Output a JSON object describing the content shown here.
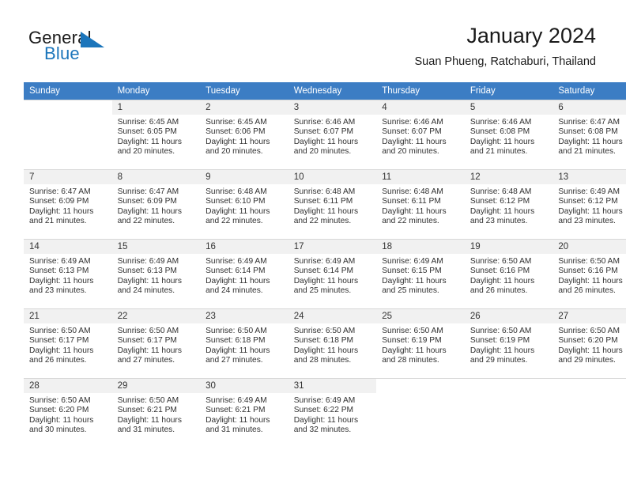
{
  "branding": {
    "name_part1": "General",
    "name_part2": "Blue",
    "accent_color": "#1b75bb"
  },
  "header": {
    "title": "January 2024",
    "subtitle": "Suan Phueng, Ratchaburi, Thailand"
  },
  "calendar": {
    "header_bg": "#3c7dc4",
    "daynum_bg": "#f1f1f1",
    "weekday_headers": [
      "Sunday",
      "Monday",
      "Tuesday",
      "Wednesday",
      "Thursday",
      "Friday",
      "Saturday"
    ],
    "weeks": [
      [
        {
          "day": "",
          "sunrise": "",
          "sunset": "",
          "daylight": "",
          "daylight2": ""
        },
        {
          "day": "1",
          "sunrise": "Sunrise: 6:45 AM",
          "sunset": "Sunset: 6:05 PM",
          "daylight": "Daylight: 11 hours",
          "daylight2": "and 20 minutes."
        },
        {
          "day": "2",
          "sunrise": "Sunrise: 6:45 AM",
          "sunset": "Sunset: 6:06 PM",
          "daylight": "Daylight: 11 hours",
          "daylight2": "and 20 minutes."
        },
        {
          "day": "3",
          "sunrise": "Sunrise: 6:46 AM",
          "sunset": "Sunset: 6:07 PM",
          "daylight": "Daylight: 11 hours",
          "daylight2": "and 20 minutes."
        },
        {
          "day": "4",
          "sunrise": "Sunrise: 6:46 AM",
          "sunset": "Sunset: 6:07 PM",
          "daylight": "Daylight: 11 hours",
          "daylight2": "and 20 minutes."
        },
        {
          "day": "5",
          "sunrise": "Sunrise: 6:46 AM",
          "sunset": "Sunset: 6:08 PM",
          "daylight": "Daylight: 11 hours",
          "daylight2": "and 21 minutes."
        },
        {
          "day": "6",
          "sunrise": "Sunrise: 6:47 AM",
          "sunset": "Sunset: 6:08 PM",
          "daylight": "Daylight: 11 hours",
          "daylight2": "and 21 minutes."
        }
      ],
      [
        {
          "day": "7",
          "sunrise": "Sunrise: 6:47 AM",
          "sunset": "Sunset: 6:09 PM",
          "daylight": "Daylight: 11 hours",
          "daylight2": "and 21 minutes."
        },
        {
          "day": "8",
          "sunrise": "Sunrise: 6:47 AM",
          "sunset": "Sunset: 6:09 PM",
          "daylight": "Daylight: 11 hours",
          "daylight2": "and 22 minutes."
        },
        {
          "day": "9",
          "sunrise": "Sunrise: 6:48 AM",
          "sunset": "Sunset: 6:10 PM",
          "daylight": "Daylight: 11 hours",
          "daylight2": "and 22 minutes."
        },
        {
          "day": "10",
          "sunrise": "Sunrise: 6:48 AM",
          "sunset": "Sunset: 6:11 PM",
          "daylight": "Daylight: 11 hours",
          "daylight2": "and 22 minutes."
        },
        {
          "day": "11",
          "sunrise": "Sunrise: 6:48 AM",
          "sunset": "Sunset: 6:11 PM",
          "daylight": "Daylight: 11 hours",
          "daylight2": "and 22 minutes."
        },
        {
          "day": "12",
          "sunrise": "Sunrise: 6:48 AM",
          "sunset": "Sunset: 6:12 PM",
          "daylight": "Daylight: 11 hours",
          "daylight2": "and 23 minutes."
        },
        {
          "day": "13",
          "sunrise": "Sunrise: 6:49 AM",
          "sunset": "Sunset: 6:12 PM",
          "daylight": "Daylight: 11 hours",
          "daylight2": "and 23 minutes."
        }
      ],
      [
        {
          "day": "14",
          "sunrise": "Sunrise: 6:49 AM",
          "sunset": "Sunset: 6:13 PM",
          "daylight": "Daylight: 11 hours",
          "daylight2": "and 23 minutes."
        },
        {
          "day": "15",
          "sunrise": "Sunrise: 6:49 AM",
          "sunset": "Sunset: 6:13 PM",
          "daylight": "Daylight: 11 hours",
          "daylight2": "and 24 minutes."
        },
        {
          "day": "16",
          "sunrise": "Sunrise: 6:49 AM",
          "sunset": "Sunset: 6:14 PM",
          "daylight": "Daylight: 11 hours",
          "daylight2": "and 24 minutes."
        },
        {
          "day": "17",
          "sunrise": "Sunrise: 6:49 AM",
          "sunset": "Sunset: 6:14 PM",
          "daylight": "Daylight: 11 hours",
          "daylight2": "and 25 minutes."
        },
        {
          "day": "18",
          "sunrise": "Sunrise: 6:49 AM",
          "sunset": "Sunset: 6:15 PM",
          "daylight": "Daylight: 11 hours",
          "daylight2": "and 25 minutes."
        },
        {
          "day": "19",
          "sunrise": "Sunrise: 6:50 AM",
          "sunset": "Sunset: 6:16 PM",
          "daylight": "Daylight: 11 hours",
          "daylight2": "and 26 minutes."
        },
        {
          "day": "20",
          "sunrise": "Sunrise: 6:50 AM",
          "sunset": "Sunset: 6:16 PM",
          "daylight": "Daylight: 11 hours",
          "daylight2": "and 26 minutes."
        }
      ],
      [
        {
          "day": "21",
          "sunrise": "Sunrise: 6:50 AM",
          "sunset": "Sunset: 6:17 PM",
          "daylight": "Daylight: 11 hours",
          "daylight2": "and 26 minutes."
        },
        {
          "day": "22",
          "sunrise": "Sunrise: 6:50 AM",
          "sunset": "Sunset: 6:17 PM",
          "daylight": "Daylight: 11 hours",
          "daylight2": "and 27 minutes."
        },
        {
          "day": "23",
          "sunrise": "Sunrise: 6:50 AM",
          "sunset": "Sunset: 6:18 PM",
          "daylight": "Daylight: 11 hours",
          "daylight2": "and 27 minutes."
        },
        {
          "day": "24",
          "sunrise": "Sunrise: 6:50 AM",
          "sunset": "Sunset: 6:18 PM",
          "daylight": "Daylight: 11 hours",
          "daylight2": "and 28 minutes."
        },
        {
          "day": "25",
          "sunrise": "Sunrise: 6:50 AM",
          "sunset": "Sunset: 6:19 PM",
          "daylight": "Daylight: 11 hours",
          "daylight2": "and 28 minutes."
        },
        {
          "day": "26",
          "sunrise": "Sunrise: 6:50 AM",
          "sunset": "Sunset: 6:19 PM",
          "daylight": "Daylight: 11 hours",
          "daylight2": "and 29 minutes."
        },
        {
          "day": "27",
          "sunrise": "Sunrise: 6:50 AM",
          "sunset": "Sunset: 6:20 PM",
          "daylight": "Daylight: 11 hours",
          "daylight2": "and 29 minutes."
        }
      ],
      [
        {
          "day": "28",
          "sunrise": "Sunrise: 6:50 AM",
          "sunset": "Sunset: 6:20 PM",
          "daylight": "Daylight: 11 hours",
          "daylight2": "and 30 minutes."
        },
        {
          "day": "29",
          "sunrise": "Sunrise: 6:50 AM",
          "sunset": "Sunset: 6:21 PM",
          "daylight": "Daylight: 11 hours",
          "daylight2": "and 31 minutes."
        },
        {
          "day": "30",
          "sunrise": "Sunrise: 6:49 AM",
          "sunset": "Sunset: 6:21 PM",
          "daylight": "Daylight: 11 hours",
          "daylight2": "and 31 minutes."
        },
        {
          "day": "31",
          "sunrise": "Sunrise: 6:49 AM",
          "sunset": "Sunset: 6:22 PM",
          "daylight": "Daylight: 11 hours",
          "daylight2": "and 32 minutes."
        },
        {
          "day": "",
          "sunrise": "",
          "sunset": "",
          "daylight": "",
          "daylight2": ""
        },
        {
          "day": "",
          "sunrise": "",
          "sunset": "",
          "daylight": "",
          "daylight2": ""
        },
        {
          "day": "",
          "sunrise": "",
          "sunset": "",
          "daylight": "",
          "daylight2": ""
        }
      ]
    ]
  }
}
